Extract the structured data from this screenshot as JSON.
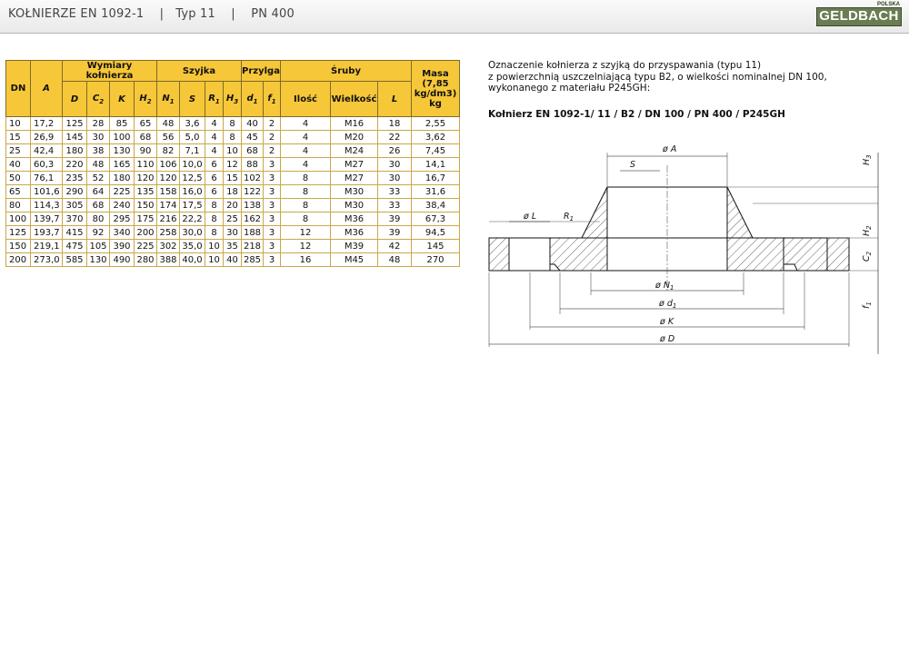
{
  "header": {
    "title": "KOŁNIERZE EN 1092-1    |   Typ 11    |    PN 400",
    "logo_text": "GELDBACH",
    "logo_subtext": "POLSKA"
  },
  "table": {
    "groups": {
      "dn": "DN",
      "wymiary": "Wymiary kołnierza",
      "szyjka": "Szyjka",
      "przylga": "Przylga",
      "sruby": "Śruby",
      "masa": "Masa (7,85 kg/dm3) kg"
    },
    "symbols": {
      "A": "A",
      "D": "D",
      "C": "C",
      "C_sub": "2",
      "K": "K",
      "H": "H",
      "H_sub": "2",
      "N": "N",
      "N_sub": "1",
      "S": "S",
      "R": "R",
      "R_sub": "1",
      "H3": "H",
      "H3_sub": "3",
      "d": "d",
      "d_sub": "1",
      "f": "f",
      "f_sub": "1",
      "ilosc": "Ilość",
      "wielkosc": "Wielkość",
      "L": "L"
    },
    "rows": [
      [
        "10",
        "17,2",
        "125",
        "28",
        "85",
        "65",
        "48",
        "3,6",
        "4",
        "8",
        "40",
        "2",
        "4",
        "M16",
        "18",
        "2,55"
      ],
      [
        "15",
        "26,9",
        "145",
        "30",
        "100",
        "68",
        "56",
        "5,0",
        "4",
        "8",
        "45",
        "2",
        "4",
        "M20",
        "22",
        "3,62"
      ],
      [
        "25",
        "42,4",
        "180",
        "38",
        "130",
        "90",
        "82",
        "7,1",
        "4",
        "10",
        "68",
        "2",
        "4",
        "M24",
        "26",
        "7,45"
      ],
      [
        "40",
        "60,3",
        "220",
        "48",
        "165",
        "110",
        "106",
        "10,0",
        "6",
        "12",
        "88",
        "3",
        "4",
        "M27",
        "30",
        "14,1"
      ],
      [
        "50",
        "76,1",
        "235",
        "52",
        "180",
        "120",
        "120",
        "12,5",
        "6",
        "15",
        "102",
        "3",
        "8",
        "M27",
        "30",
        "16,7"
      ],
      [
        "65",
        "101,6",
        "290",
        "64",
        "225",
        "135",
        "158",
        "16,0",
        "6",
        "18",
        "122",
        "3",
        "8",
        "M30",
        "33",
        "31,6"
      ],
      [
        "80",
        "114,3",
        "305",
        "68",
        "240",
        "150",
        "174",
        "17,5",
        "8",
        "20",
        "138",
        "3",
        "8",
        "M30",
        "33",
        "38,4"
      ],
      [
        "100",
        "139,7",
        "370",
        "80",
        "295",
        "175",
        "216",
        "22,2",
        "8",
        "25",
        "162",
        "3",
        "8",
        "M36",
        "39",
        "67,3"
      ],
      [
        "125",
        "193,7",
        "415",
        "92",
        "340",
        "200",
        "258",
        "30,0",
        "8",
        "30",
        "188",
        "3",
        "12",
        "M36",
        "39",
        "94,5"
      ],
      [
        "150",
        "219,1",
        "475",
        "105",
        "390",
        "225",
        "302",
        "35,0",
        "10",
        "35",
        "218",
        "3",
        "12",
        "M39",
        "42",
        "145"
      ],
      [
        "200",
        "273,0",
        "585",
        "130",
        "490",
        "280",
        "388",
        "40,0",
        "10",
        "40",
        "285",
        "3",
        "16",
        "M45",
        "48",
        "270"
      ]
    ]
  },
  "description": {
    "line1": "Oznaczenie kołnierza z szyjką do przyspawania (typu 11)",
    "line2": "z powierzchnią uszczelniającą typu B2, o wielkości nominalnej DN 100,",
    "line3": "wykonanego z materiału P245GH:",
    "designation": "Kołnierz EN 1092-1/ 11 / B2 / DN 100 / PN 400 / P245GH"
  },
  "drawing": {
    "phi_A": "ø A",
    "S": "S",
    "H": "H",
    "H3_sub": "3",
    "H2_sub": "2",
    "C2_sub": "2",
    "C": "C",
    "phi_L": "ø L",
    "R": "R",
    "R1_sub": "1",
    "phi_N": "ø N",
    "N1_sub": "1",
    "phi_d": "ø d",
    "d1_sub": "1",
    "phi_K": "ø K",
    "phi_D": "ø D",
    "f": "f",
    "f1_sub": "1"
  }
}
